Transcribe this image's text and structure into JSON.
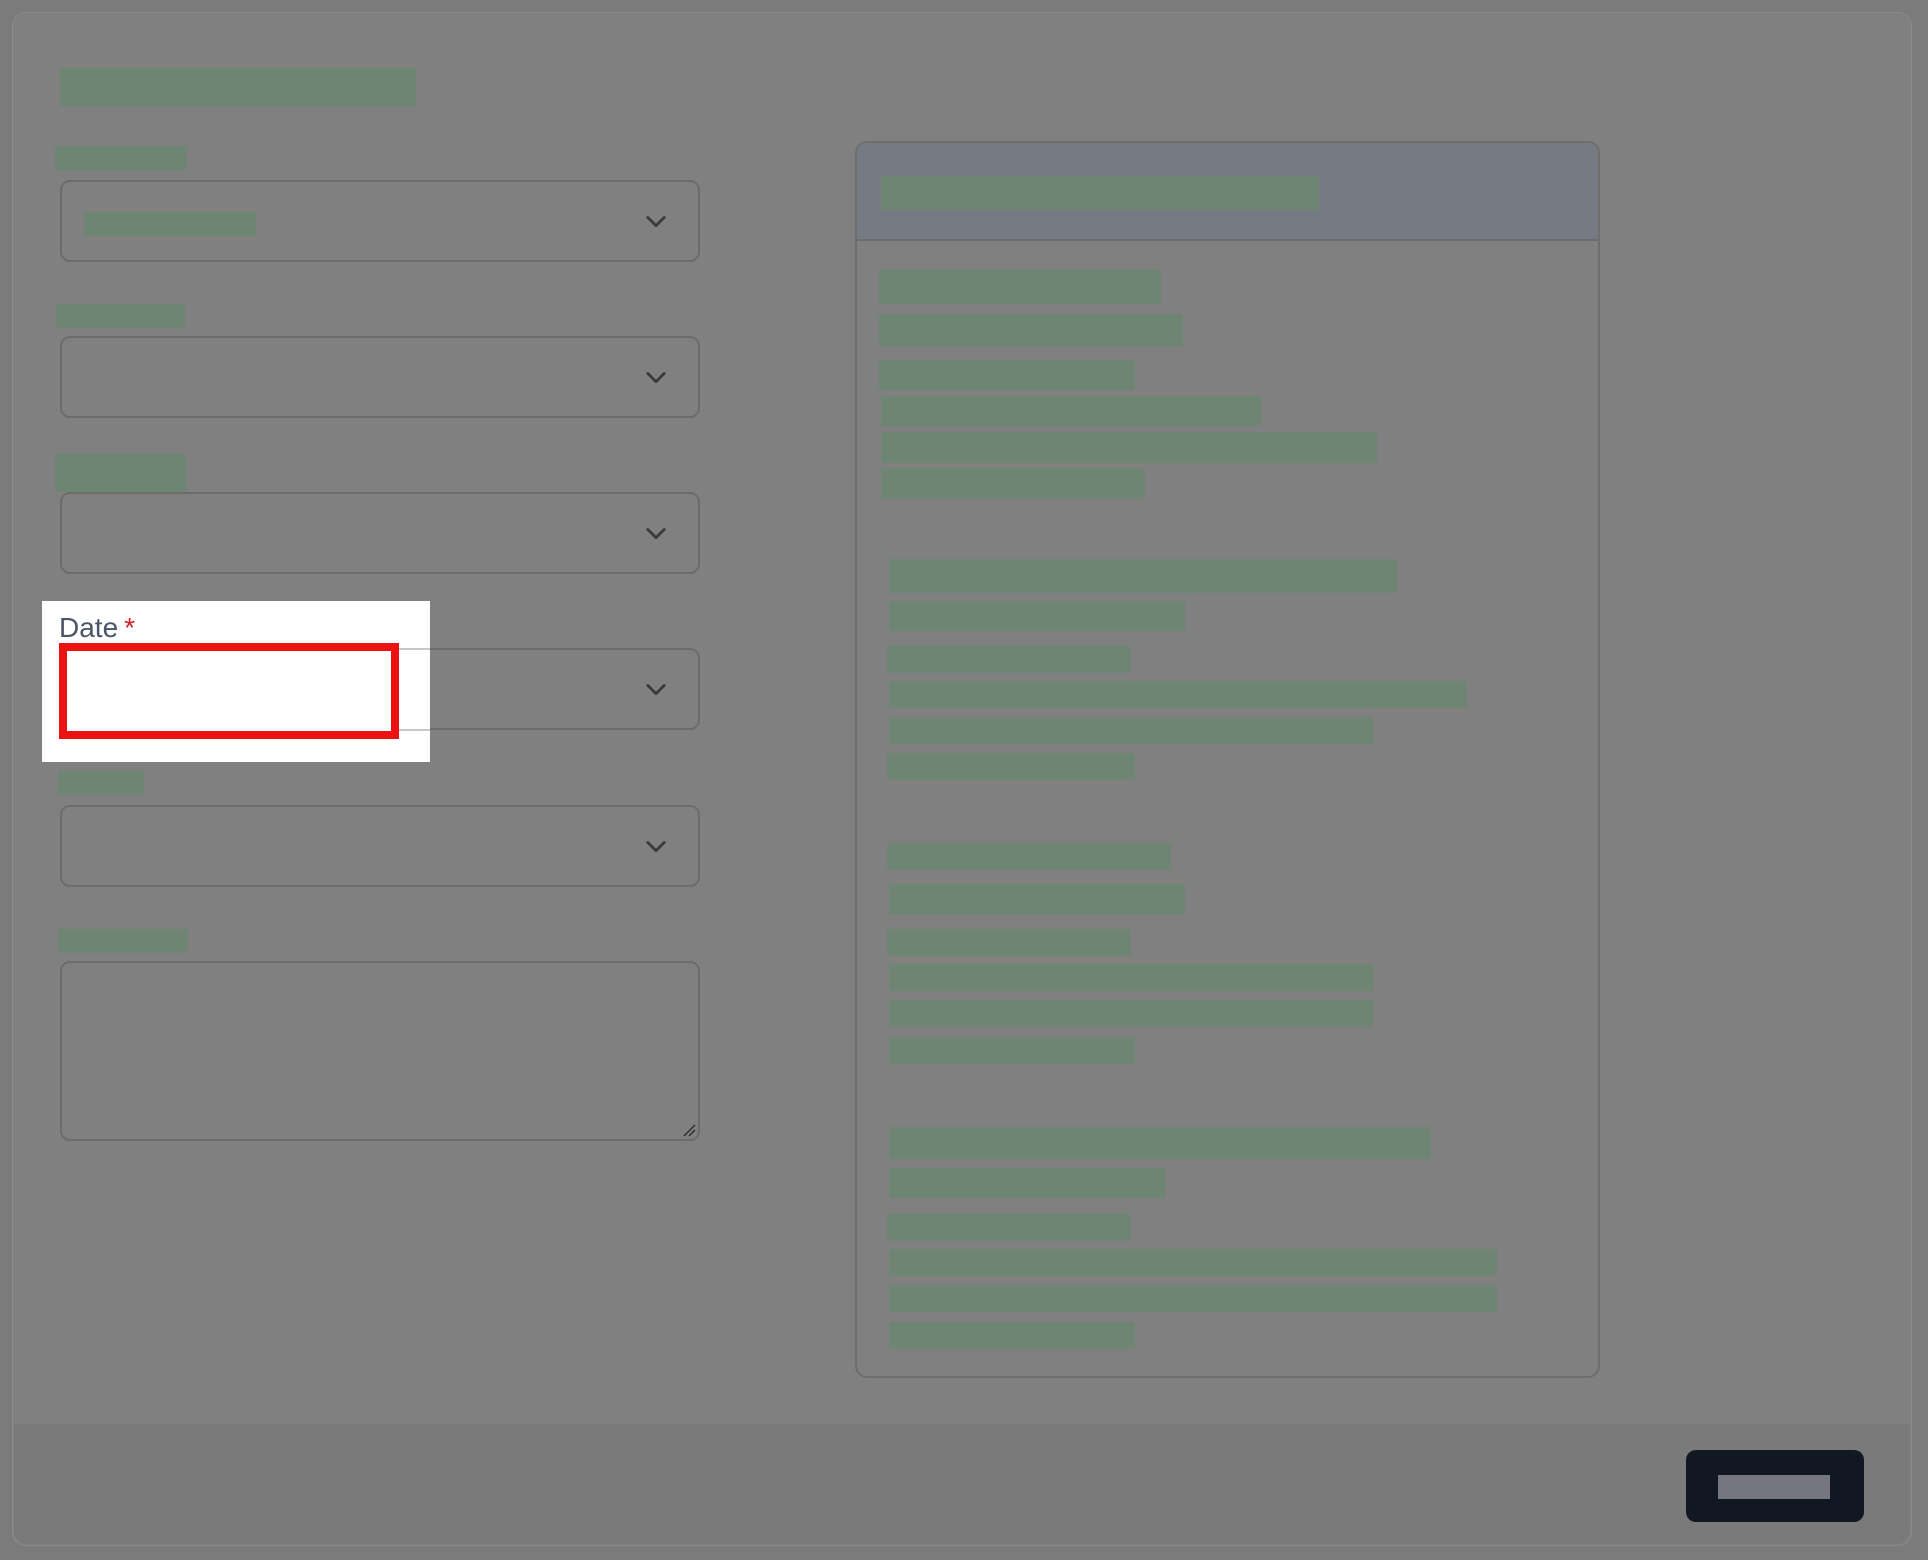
{
  "form": {
    "date_field": {
      "label": "Date",
      "required_mark": "*",
      "value": ""
    }
  },
  "icons": {
    "select_chevron": "chevron-down-icon",
    "textarea_resize": "resize-grip-icon"
  },
  "colors": {
    "highlight_border": "#ee1111",
    "required_mark": "#cc2222",
    "button_background": "#121821",
    "overlay": "#808080",
    "redaction": "#6e8573"
  }
}
